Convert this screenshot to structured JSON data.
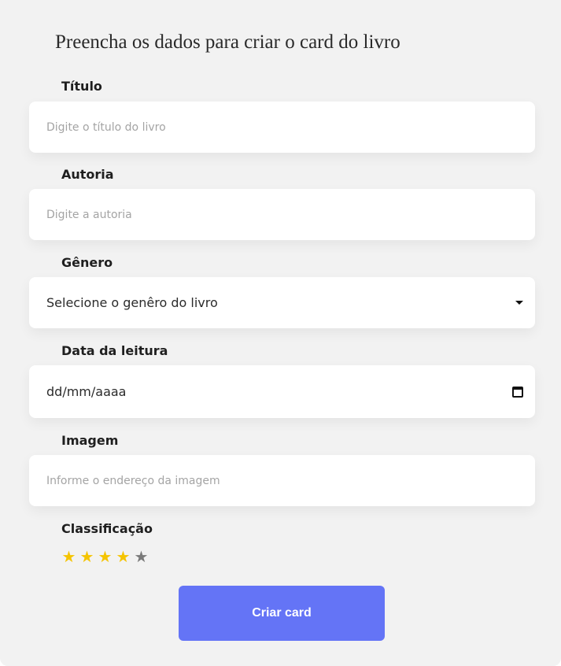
{
  "form": {
    "title": "Preencha os dados para criar o card do livro",
    "titulo": {
      "label": "Título",
      "placeholder": "Digite o título do livro"
    },
    "autoria": {
      "label": "Autoria",
      "placeholder": "Digite a autoria"
    },
    "genero": {
      "label": "Gênero",
      "selected": "Selecione o genêro do livro",
      "icon": "chevron-down-icon"
    },
    "data_leitura": {
      "label": "Data da leitura",
      "value": "dd/mm/aaaa",
      "icon": "calendar-icon"
    },
    "imagem": {
      "label": "Imagem",
      "placeholder": "Informe o endereço da imagem"
    },
    "classificacao": {
      "label": "Classificação",
      "star_glyph": "★",
      "rating": 4,
      "max": 5,
      "filled_color": "#f5c400",
      "empty_color": "#7a7a7a"
    },
    "submit_label": "Criar card",
    "accent_color": "#6474f6"
  }
}
